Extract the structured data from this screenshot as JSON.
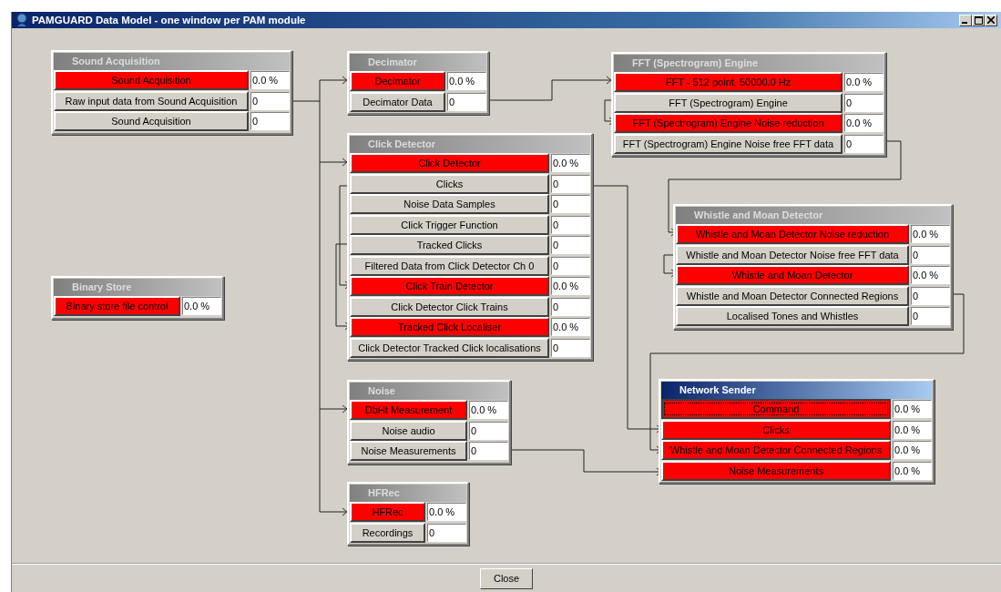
{
  "window": {
    "title": "PAMGUARD Data Model - one window per PAM module"
  },
  "modules": [
    {
      "title": "Sound Acquisition",
      "selected": false,
      "rows": [
        {
          "label": "Sound Acquisition",
          "kind": "process",
          "focused": false,
          "value": "0.0 %"
        },
        {
          "label": "Raw input data from Sound Acquisition",
          "kind": "data",
          "focused": false,
          "value": "0"
        },
        {
          "label": "Sound Acquisition",
          "kind": "data",
          "focused": false,
          "value": "0"
        }
      ]
    },
    {
      "title": "Decimator",
      "selected": false,
      "rows": [
        {
          "label": "Decimator",
          "kind": "process",
          "focused": false,
          "value": "0.0 %"
        },
        {
          "label": "Decimator Data",
          "kind": "data",
          "focused": false,
          "value": "0"
        }
      ]
    },
    {
      "title": "FFT (Spectrogram) Engine",
      "selected": false,
      "rows": [
        {
          "label": "FFT - 512 point, 50000.0 Hz",
          "kind": "process",
          "focused": false,
          "value": "0.0 %"
        },
        {
          "label": "FFT (Spectrogram) Engine",
          "kind": "data",
          "focused": false,
          "value": "0"
        },
        {
          "label": "FFT (Spectrogram) Engine Noise reduction",
          "kind": "process",
          "focused": false,
          "value": "0.0 %"
        },
        {
          "label": "FFT (Spectrogram) Engine Noise free FFT data",
          "kind": "data",
          "focused": false,
          "value": "0"
        }
      ]
    },
    {
      "title": "Click Detector",
      "selected": false,
      "rows": [
        {
          "label": "Click Detector",
          "kind": "process",
          "focused": false,
          "value": "0.0 %"
        },
        {
          "label": "Clicks",
          "kind": "data",
          "focused": false,
          "value": "0"
        },
        {
          "label": "Noise Data Samples",
          "kind": "data",
          "focused": false,
          "value": "0"
        },
        {
          "label": "Click Trigger Function",
          "kind": "data",
          "focused": false,
          "value": "0"
        },
        {
          "label": "Tracked Clicks",
          "kind": "data",
          "focused": false,
          "value": "0"
        },
        {
          "label": "Filtered Data from Click Detector Ch 0",
          "kind": "data",
          "focused": false,
          "value": "0"
        },
        {
          "label": "Click Train Detector",
          "kind": "process",
          "focused": false,
          "value": "0.0 %"
        },
        {
          "label": "Click Detector Click Trains",
          "kind": "data",
          "focused": false,
          "value": "0"
        },
        {
          "label": "Tracked Click Localiser",
          "kind": "process",
          "focused": false,
          "value": "0.0 %"
        },
        {
          "label": "Click Detector Tracked Click localisations",
          "kind": "data",
          "focused": false,
          "value": "0"
        }
      ]
    },
    {
      "title": "Whistle and Moan Detector",
      "selected": false,
      "rows": [
        {
          "label": "Whistle and Moan Detector Noise reduction",
          "kind": "process",
          "focused": false,
          "value": "0.0 %"
        },
        {
          "label": "Whistle and Moan Detector Noise free FFT data",
          "kind": "data",
          "focused": false,
          "value": "0"
        },
        {
          "label": "Whistle and Moan Detector",
          "kind": "process",
          "focused": false,
          "value": "0.0 %"
        },
        {
          "label": "Whistle and Moan Detector Connected Regions",
          "kind": "data",
          "focused": false,
          "value": "0"
        },
        {
          "label": "Localised Tones and Whistles",
          "kind": "data",
          "focused": false,
          "value": "0"
        }
      ]
    },
    {
      "title": "Binary Store",
      "selected": false,
      "rows": [
        {
          "label": "Binary store file control",
          "kind": "process",
          "focused": false,
          "value": "0.0 %"
        }
      ]
    },
    {
      "title": "Noise",
      "selected": false,
      "rows": [
        {
          "label": "DbHt Measurement",
          "kind": "process",
          "focused": false,
          "value": "0.0 %"
        },
        {
          "label": "Noise audio",
          "kind": "data",
          "focused": false,
          "value": "0"
        },
        {
          "label": "Noise Measurements",
          "kind": "data",
          "focused": false,
          "value": "0"
        }
      ]
    },
    {
      "title": "HFRec",
      "selected": false,
      "rows": [
        {
          "label": "HFRec",
          "kind": "process",
          "focused": false,
          "value": "0.0 %"
        },
        {
          "label": "Recordings",
          "kind": "data",
          "focused": false,
          "value": "0"
        }
      ]
    },
    {
      "title": "Network Sender",
      "selected": true,
      "rows": [
        {
          "label": "Command",
          "kind": "process",
          "focused": true,
          "value": "0.0 %"
        },
        {
          "label": "Clicks",
          "kind": "process",
          "focused": false,
          "value": "0.0 %"
        },
        {
          "label": "Whistle and Moan Detector Connected Regions",
          "kind": "process",
          "focused": false,
          "value": "0.0 %"
        },
        {
          "label": "Noise Measurements",
          "kind": "process",
          "focused": false,
          "value": "0.0 %"
        }
      ]
    }
  ],
  "buttons": [
    {
      "label": "Close"
    }
  ]
}
